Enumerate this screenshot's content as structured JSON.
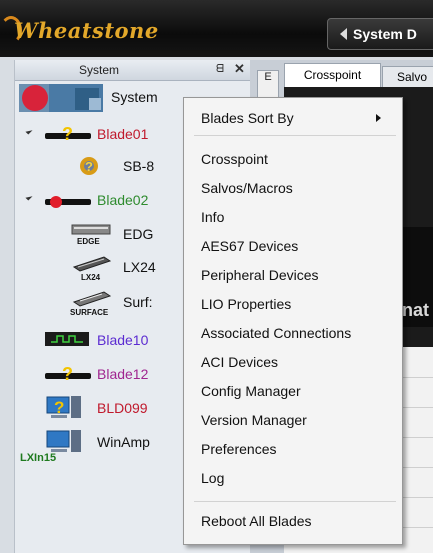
{
  "app": {
    "brand": "Wheatstone",
    "system_button": "System D"
  },
  "panel": {
    "title": "System",
    "pin_glyph": "ᗺ",
    "close_glyph": "✕",
    "root": {
      "label": "System"
    },
    "nodes": [
      {
        "label": "Blade01",
        "color": "#c0192c",
        "icon": "blade-warning-icon"
      },
      {
        "label": "SB-8",
        "color": "#111111",
        "icon": "sb-icon"
      },
      {
        "label": "Blade02",
        "color": "#2e8b2e",
        "icon": "blade-error-icon"
      },
      {
        "label": "EDG",
        "color": "#111111",
        "icon": "edge-icon",
        "badge": "EDGE"
      },
      {
        "label": "LX24",
        "color": "#111111",
        "icon": "lx24-icon",
        "badge": "LX24"
      },
      {
        "label": "Surf:",
        "color": "#111111",
        "icon": "surface-icon",
        "badge": "SURFACE"
      },
      {
        "label": "Blade10",
        "color": "#5b2bd1",
        "icon": "waveform-blade-icon"
      },
      {
        "label": "Blade12",
        "color": "#a0258f",
        "icon": "blade-warning-icon"
      },
      {
        "label": "BLD099",
        "color": "#c0192c",
        "icon": "computer-warning-icon"
      },
      {
        "label": "WinAmp",
        "color": "#111111",
        "icon": "computer-icon"
      }
    ]
  },
  "tabs": {
    "vertical": "E",
    "crosspoint": "Crosspoint",
    "salvos": "Salvo"
  },
  "content": {
    "watermark_text": "nat",
    "grid_label": "LXIn15"
  },
  "menu": {
    "sort_by": "Blades Sort By",
    "items": [
      "Crosspoint",
      "Salvos/Macros",
      "Info",
      "AES67 Devices",
      "Peripheral Devices",
      "LIO Properties",
      "Associated Connections",
      "ACI Devices",
      "Config Manager",
      "Version Manager",
      "Preferences",
      "Log"
    ],
    "reboot": "Reboot All Blades"
  }
}
